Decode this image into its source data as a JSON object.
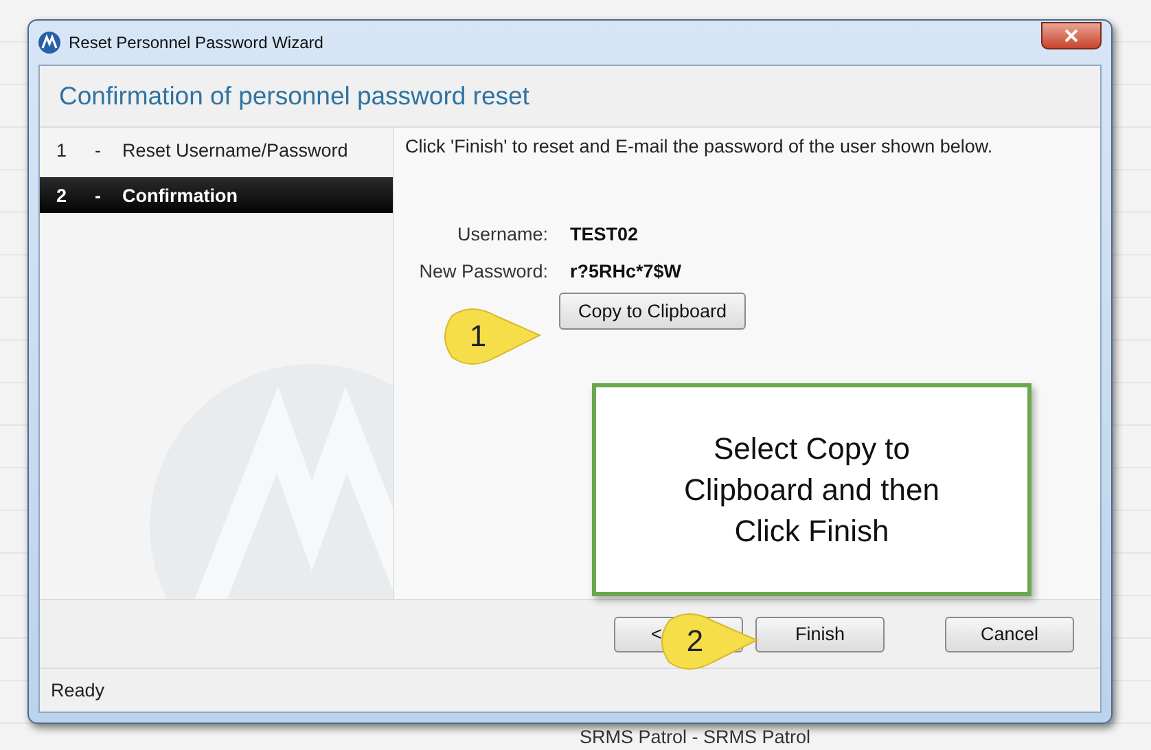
{
  "window": {
    "title": "Reset Personnel Password Wizard"
  },
  "header": "Confirmation of personnel password reset",
  "steps": [
    {
      "number": "1",
      "separator": "-",
      "label": "Reset Username/Password",
      "selected": false
    },
    {
      "number": "2",
      "separator": "-",
      "label": "Confirmation",
      "selected": true
    }
  ],
  "instruction": "Click 'Finish' to reset and E-mail the password of the user shown below.",
  "fields": [
    {
      "label": "Username:",
      "value": "TEST02"
    },
    {
      "label": "New Password:",
      "value": "r?5RHc*7$W"
    }
  ],
  "copy_button": "Copy to Clipboard",
  "callouts": [
    {
      "number": "1"
    },
    {
      "number": "2"
    }
  ],
  "note": "Select Copy to Clipboard and then Click Finish",
  "buttons": [
    {
      "label": "<"
    },
    {
      "label": "Finish"
    },
    {
      "label": "Cancel"
    }
  ],
  "status_bar": "Ready",
  "background_text": "SRMS Patrol - SRMS Patrol"
}
